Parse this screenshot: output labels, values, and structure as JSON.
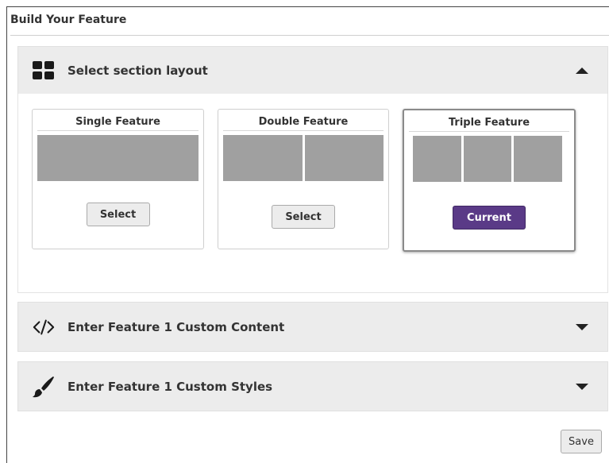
{
  "page": {
    "title": "Build Your Feature"
  },
  "panels": {
    "layout": {
      "label": "Select section layout",
      "icon": "grid-layout-icon",
      "state": "expanded"
    },
    "content": {
      "label": "Enter Feature 1 Custom Content",
      "icon": "code-icon",
      "state": "collapsed"
    },
    "styles": {
      "label": "Enter Feature 1 Custom Styles",
      "icon": "paintbrush-icon",
      "state": "collapsed"
    }
  },
  "layouts": [
    {
      "title": "Single Feature",
      "button": "Select",
      "thumbs": 1,
      "current": false
    },
    {
      "title": "Double Feature",
      "button": "Select",
      "thumbs": 2,
      "current": false
    },
    {
      "title": "Triple Feature",
      "button": "Current",
      "thumbs": 3,
      "current": true
    }
  ],
  "footer": {
    "save_label": "Save"
  },
  "colors": {
    "current_button": "#5a3a87",
    "panel_header": "#ececec",
    "thumb": "#a0a0a0"
  }
}
